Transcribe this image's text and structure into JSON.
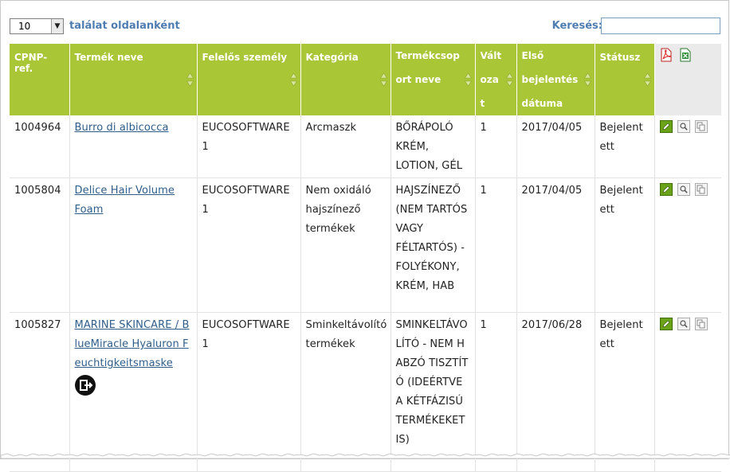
{
  "toolbar": {
    "page_size_value": "10",
    "page_size_label": "találat oldalanként",
    "search_label": "Keresés:",
    "search_value": ""
  },
  "columns": [
    {
      "label": "CPNP-ref.",
      "sortable": false
    },
    {
      "label": "Termék neve",
      "sortable": true
    },
    {
      "label": "Felelős személy",
      "sortable": true
    },
    {
      "label": "Kategória",
      "sortable": true
    },
    {
      "label": "Termékcsoport neve",
      "sortable": true
    },
    {
      "label": "Változat",
      "sortable": true
    },
    {
      "label": "Első bejelentés dátuma",
      "sortable": true
    },
    {
      "label": "Státusz",
      "sortable": true
    }
  ],
  "header_icons": [
    "pdf-export-icon",
    "excel-export-icon"
  ],
  "rows": [
    {
      "ref": "1004964",
      "name": "Burro di albicocca",
      "responsible": "EUCOSOFTWARE 1",
      "category": "Arcmaszk",
      "group": "BŐRÁPOLÓ KRÉM, LOTION, GÉL",
      "variant": "1",
      "date": "2017/04/05",
      "status": "Bejelentett"
    },
    {
      "ref": "1005804",
      "name": "Delice Hair Volume Foam",
      "responsible": "EUCOSOFTWARE 1",
      "category": "Nem oxidáló hajszínező termékek",
      "group": "HAJSZÍNEZŐ (NEM TARTÓS VAGY FÉLTARTÓS) - FOLYÉKONY, KRÉM, HAB",
      "variant": "1",
      "date": "2017/04/05",
      "status": "Bejelentett"
    },
    {
      "ref": "1005827",
      "name": "MARINE SKINCARE / BlueMiracle Hyaluron Feuchtigkeitsmaske",
      "responsible": "EUCOSOFTWARE 1",
      "category": "Sminkeltávolító termékek",
      "group": "SMINKELTÁVOLÍTÓ - NEM HABZÓ TISZTÍTÓ (IDEÉRTVE A KÉTFÁZISÚ TERMÉKEKET IS)",
      "variant": "1",
      "date": "2017/06/28",
      "status": "Bejelentett"
    }
  ],
  "row_action_icons": [
    "edit-icon",
    "view-icon",
    "copy-icon"
  ],
  "colors": {
    "header_bg": "#a9c637",
    "accent_text": "#4f7db1",
    "link": "#2f5d8a"
  }
}
